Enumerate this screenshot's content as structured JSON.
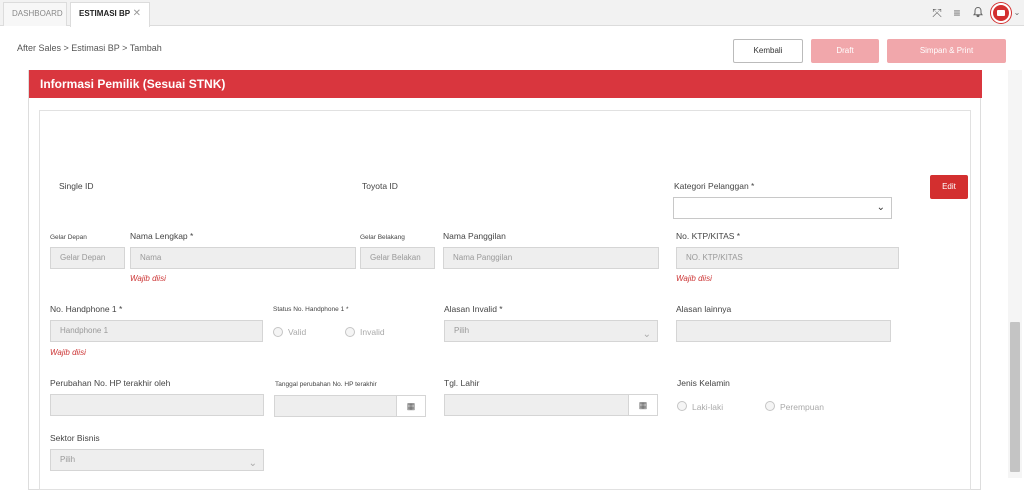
{
  "tabs": [
    {
      "label": "DASHBOARD"
    },
    {
      "label": "ESTIMASI BP",
      "close": "✕"
    }
  ],
  "breadcrumb": {
    "text": "After Sales > Estimasi BP > Tambah"
  },
  "actions": {
    "kembali": "Kembali",
    "draft": "Draft",
    "simpan": "Simpan & Print"
  },
  "section": {
    "title": "Informasi Pemilik (Sesuai STNK)",
    "edit": "Edit"
  },
  "fields": {
    "single_id": "Single ID",
    "toyota_id": "Toyota ID",
    "kategori": "Kategori Pelanggan *",
    "gelar_depan_label": "Gelar Depan",
    "gelar_depan_ph": "Gelar Depan",
    "nama_label": "Nama Lengkap *",
    "nama_ph": "Nama",
    "gelar_belakang_label": "Gelar Belakang",
    "gelar_belakang_ph": "Gelar Belakan",
    "panggilan_label": "Nama Panggilan",
    "panggilan_ph": "Nama Panggilan",
    "ktp_label": "No. KTP/KITAS *",
    "ktp_ph": "NO. KTP/KITAS",
    "hp_label": "No. Handphone 1 *",
    "hp_ph": "Handphone 1",
    "status_hp_label": "Status No. Handphone 1 *",
    "valid": "Valid",
    "invalid": "Invalid",
    "alasan_label": "Alasan Invalid *",
    "alasan_value": "Pilih",
    "alasan_lain_label": "Alasan lainnya",
    "perubahan_label": "Perubahan No. HP terakhir oleh",
    "tgl_perubahan_label": "Tanggal perubahan No. HP terakhir",
    "tgl_lahir_label": "Tgl. Lahir",
    "jenis_kelamin_label": "Jenis Kelamin",
    "laki": "Laki-laki",
    "perempuan": "Perempuan",
    "sektor_label": "Sektor Bisnis",
    "sektor_value": "Pilih",
    "wajib": "Wajib diisi"
  },
  "icons": {
    "expand": "expand-icon",
    "menu": "menu-icon",
    "bell": "bell-icon",
    "calendar": "calendar-icon",
    "chevron": "chevron-down-icon"
  }
}
